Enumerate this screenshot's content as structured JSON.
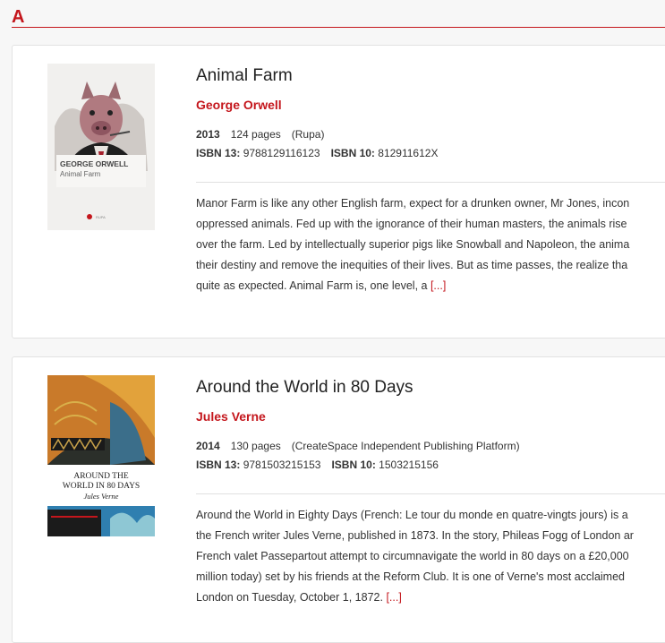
{
  "section": {
    "letter": "A"
  },
  "books": [
    {
      "title": "Animal Farm",
      "author": "George Orwell",
      "year": "2013",
      "pages": "124 pages",
      "publisher": "(Rupa)",
      "isbn13_label": "ISBN 13:",
      "isbn13": "9788129116123",
      "isbn10_label": "ISBN 10:",
      "isbn10": "812911612X",
      "description_lines": [
        "Manor Farm is like any other English farm, expect for a drunken owner, Mr Jones, incon",
        "oppressed animals. Fed up with the ignorance of their human masters, the animals rise",
        "over the farm. Led by intellectually superior pigs like Snowball and Napoleon, the anima",
        "their destiny and remove the inequities of their lives. But as time passes, the realize tha",
        "quite as expected. Animal Farm is, one level, a"
      ],
      "more": "[...]",
      "cover": {
        "line1": "GEORGE ORWELL",
        "line2": "Animal Farm",
        "footer": "RUPA"
      }
    },
    {
      "title": "Around the World in 80 Days",
      "author": "Jules Verne",
      "year": "2014",
      "pages": "130 pages",
      "publisher": "(CreateSpace Independent Publishing Platform)",
      "isbn13_label": "ISBN 13:",
      "isbn13": "9781503215153",
      "isbn10_label": "ISBN 10:",
      "isbn10": "1503215156",
      "description_lines": [
        "Around the World in Eighty Days (French: Le tour du monde en quatre-vingts jours) is a",
        "the French writer Jules Verne, published in 1873. In the story, Phileas Fogg of London ar",
        "French valet Passepartout attempt to circumnavigate the world in 80 days on a £20,000",
        "million today) set by his friends at the Reform Club. It is one of Verne's most acclaimed",
        "London on Tuesday, October 1, 1872."
      ],
      "more": "[...]",
      "cover": {
        "line1": "AROUND THE",
        "line2": "WORLD IN 80 DAYS",
        "line3": "Jules Verne"
      }
    }
  ],
  "colors": {
    "accent": "#c4161c",
    "card_bg": "#ffffff",
    "page_bg": "#f7f7f7"
  }
}
